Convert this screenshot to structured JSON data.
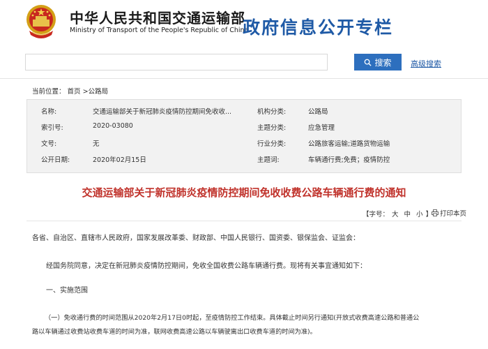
{
  "header": {
    "ministry_cn": "中华人民共和国交通运输部",
    "ministry_en": "Ministry of Transport of the People's Republic of China",
    "column_title": "政府信息公开专栏"
  },
  "search": {
    "value": "",
    "placeholder": "",
    "button_label": "搜索",
    "advanced_label": "高级搜索"
  },
  "breadcrumb": {
    "prefix": "当前位置：",
    "home": "首页",
    "sep": ">",
    "current": "公路局"
  },
  "meta": {
    "rows": [
      {
        "l1": "名称:",
        "v1": "交通运输部关于新冠肺炎疫情防控期间免收收...",
        "l2": "机构分类:",
        "v2": "公路局"
      },
      {
        "l1": "索引号:",
        "v1": "2020-03080",
        "l2": "主题分类:",
        "v2": "应急管理"
      },
      {
        "l1": "文号:",
        "v1": "无",
        "l2": "行业分类:",
        "v2": "公路旅客运输;道路货物运输"
      },
      {
        "l1": "公开日期:",
        "v1": "2020年02月15日",
        "l2": "主题词:",
        "v2": "车辆通行费;免费；疫情防控"
      }
    ]
  },
  "doc": {
    "title": "交通运输部关于新冠肺炎疫情防控期间免收收费公路车辆通行费的通知",
    "font_size_label": "【字号：",
    "size_large": "大",
    "size_medium": "中",
    "size_small": "小",
    "font_size_close": "】",
    "print_label": "打印本页"
  },
  "body": {
    "p1": "各省、自治区、直辖市人民政府，国家发展改革委、财政部、中国人民银行、国资委、银保监会、证监会：",
    "p2": "经国务院同意，决定在新冠肺炎疫情防控期间，免收全国收费公路车辆通行费。现将有关事宜通知如下：",
    "p3": "一、实施范围",
    "p4a": "（一）免收通行费的时间范围从2020年2月17日0时起，至疫情防控工作结束。具体截止时间另行通知(开放式收费高速公路和普通公",
    "p4b": "路以车辆通过收费站收费车道的时间为准，联网收费高速公路以车辆驶离出口收费车道的时间为准)。"
  },
  "colors": {
    "title_red": "#c0322b",
    "brand_blue": "#1f5aa6",
    "button_blue": "#2d6fbe"
  }
}
